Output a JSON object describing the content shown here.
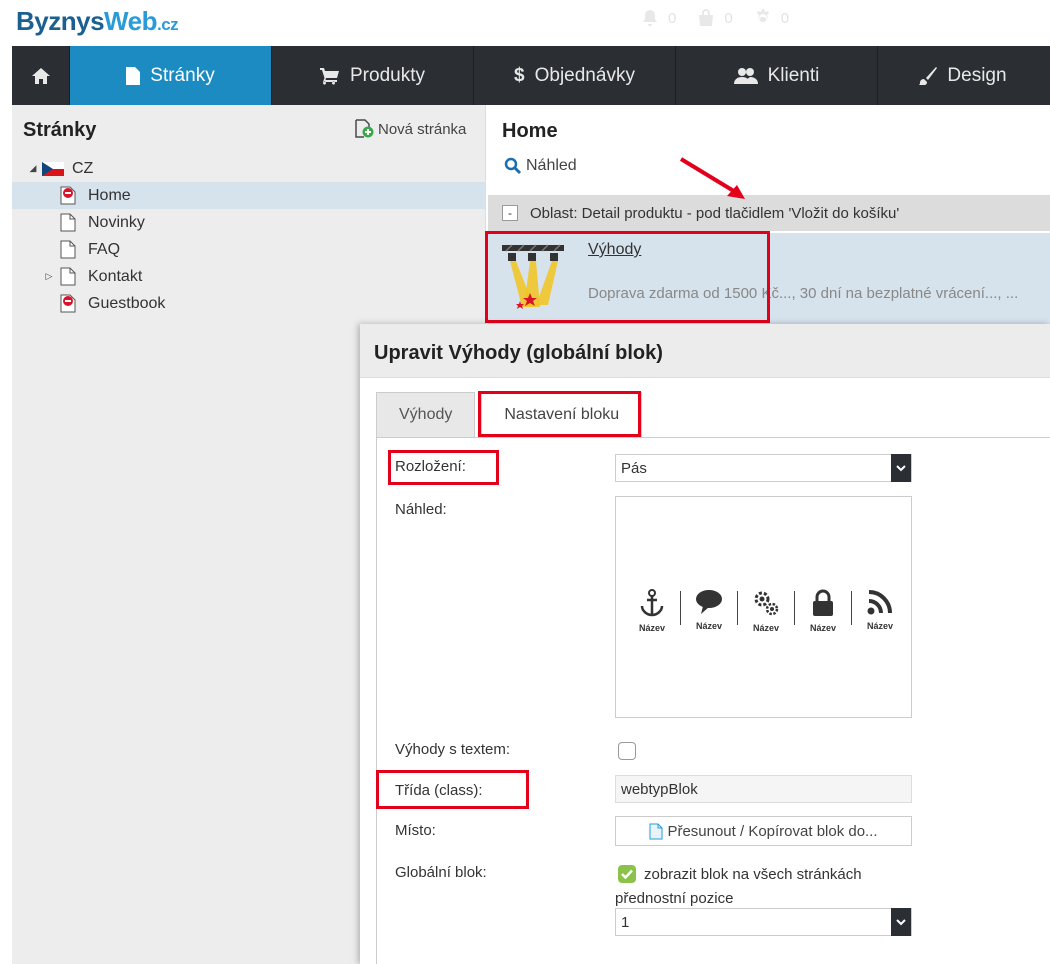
{
  "logo": {
    "part1": "Byznys",
    "part2": "Web",
    "suffix": ".cz"
  },
  "stats": [
    {
      "icon": "bell-icon",
      "value": "0"
    },
    {
      "icon": "bag-icon",
      "value": "0"
    },
    {
      "icon": "gear-icon",
      "value": "0"
    }
  ],
  "nav": {
    "home_icon": "home-icon",
    "items": [
      {
        "label": "Stránky",
        "icon": "file-icon",
        "active": true
      },
      {
        "label": "Produkty",
        "icon": "cart-icon"
      },
      {
        "label": "Objednávky",
        "icon": "dollar-icon"
      },
      {
        "label": "Klienti",
        "icon": "users-icon"
      },
      {
        "label": "Design",
        "icon": "brush-icon"
      }
    ]
  },
  "sidebar": {
    "title": "Stránky",
    "new_page": "Nová stránka",
    "root": "CZ",
    "pages": [
      {
        "label": "Home",
        "restricted": true,
        "selected": true
      },
      {
        "label": "Novinky"
      },
      {
        "label": "FAQ"
      },
      {
        "label": "Kontakt",
        "has_children": true
      },
      {
        "label": "Guestbook",
        "restricted": true
      }
    ]
  },
  "main": {
    "title": "Home",
    "preview": "Náhled",
    "area": {
      "toggle": "-",
      "label": "Oblast: Detail produktu - pod tlačidlem 'Vložit do košíku'"
    },
    "block": {
      "name": "Výhody",
      "description": "Doprava zdarma od 1500 Kč..., 30 dní na bezplatné vrácení..., ..."
    }
  },
  "dialog": {
    "title": "Upravit Výhody (globální blok)",
    "tabs": [
      {
        "label": "Výhody"
      },
      {
        "label": "Nastavení bloku",
        "active": true
      }
    ],
    "fields": {
      "layout_label": "Rozložení:",
      "layout_value": "Pás",
      "preview_label": "Náhled:",
      "preview_items": [
        {
          "icon": "anchor-icon",
          "label": "Název"
        },
        {
          "icon": "comment-icon",
          "label": "Název"
        },
        {
          "icon": "gears-icon",
          "label": "Název"
        },
        {
          "icon": "lock-icon",
          "label": "Název"
        },
        {
          "icon": "rss-icon",
          "label": "Název"
        }
      ],
      "benefits_text_label": "Výhody s textem:",
      "benefits_text_checked": false,
      "class_label": "Třída (class):",
      "class_value": "webtypBlok",
      "place_label": "Místo:",
      "place_button": "Přesunout / Kopírovat blok do...",
      "global_label": "Globální blok:",
      "global_checkbox_label": "zobrazit blok na všech stránkách",
      "global_checked": true,
      "priority_label": "přednostní pozice",
      "priority_value": "1"
    }
  },
  "colors": {
    "accent": "#1b8bc1",
    "nav_bg": "#2b2f33",
    "highlight": "#e3001b",
    "check": "#8bc34a"
  }
}
